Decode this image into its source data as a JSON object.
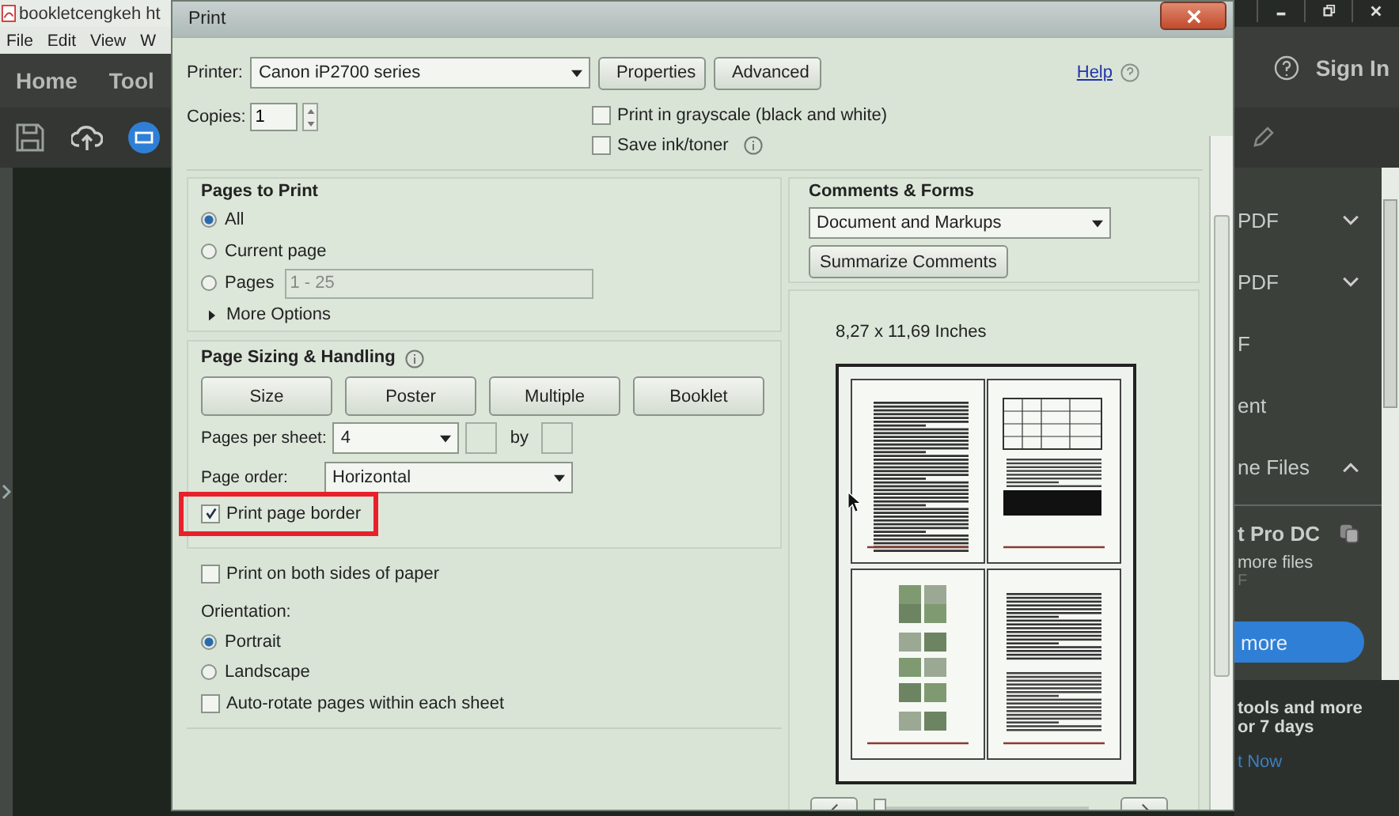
{
  "app": {
    "title": "bookletcengkeh ht",
    "menu": [
      "File",
      "Edit",
      "View",
      "W"
    ],
    "nav": [
      "Home",
      "Tool"
    ]
  },
  "sidebar": {
    "sign_in": "Sign In",
    "items": [
      {
        "label": "PDF",
        "kind": "group",
        "expanded": false
      },
      {
        "label": "PDF",
        "kind": "group",
        "expanded": false
      },
      {
        "label": "F",
        "kind": "plain"
      },
      {
        "label": "ent",
        "kind": "plain"
      },
      {
        "label": "ne Files",
        "kind": "group",
        "expanded": true
      }
    ],
    "promo": {
      "title": "t Pro DC",
      "lines": [
        "more files",
        "F"
      ],
      "button": "more"
    },
    "trial": {
      "lines": [
        "tools and more",
        "or 7 days"
      ],
      "link": "t Now"
    }
  },
  "dialog": {
    "title": "Print",
    "printer": {
      "label": "Printer:",
      "value": "Canon iP2700 series"
    },
    "top_buttons": [
      "Properties",
      "Advanced"
    ],
    "help": "Help",
    "copies": {
      "label": "Copies:",
      "value": "1"
    },
    "options": [
      {
        "label": "Print in grayscale (black and white)",
        "checked": false,
        "info": false
      },
      {
        "label": "Save ink/toner",
        "checked": false,
        "info": true
      }
    ],
    "pages_to_print": {
      "title": "Pages to Print",
      "choices": [
        {
          "label": "All",
          "selected": true
        },
        {
          "label": "Current page",
          "selected": false
        },
        {
          "label": "Pages",
          "selected": false,
          "range": "1 - 25"
        }
      ],
      "more_options": "More Options"
    },
    "sizing": {
      "title": "Page Sizing & Handling",
      "modes": [
        "Size",
        "Poster",
        "Multiple",
        "Booklet"
      ],
      "pages_per_sheet": {
        "label": "Pages per sheet:",
        "value": "4",
        "by": "by"
      },
      "page_order": {
        "label": "Page order:",
        "value": "Horizontal"
      },
      "print_border": {
        "label": "Print page border",
        "checked": true,
        "highlighted": true
      }
    },
    "duplex": {
      "label": "Print on both sides of paper",
      "checked": false
    },
    "orientation": {
      "title": "Orientation:",
      "choices": [
        {
          "label": "Portrait",
          "selected": true
        },
        {
          "label": "Landscape",
          "selected": false
        }
      ]
    },
    "auto_rotate": {
      "label": "Auto-rotate pages within each sheet",
      "checked": false
    },
    "comments": {
      "title": "Comments & Forms",
      "value": "Document and Markups",
      "button": "Summarize Comments"
    },
    "preview": {
      "size": "8,27 x 11,69 Inches",
      "page_slider": {
        "level": 0
      }
    }
  }
}
